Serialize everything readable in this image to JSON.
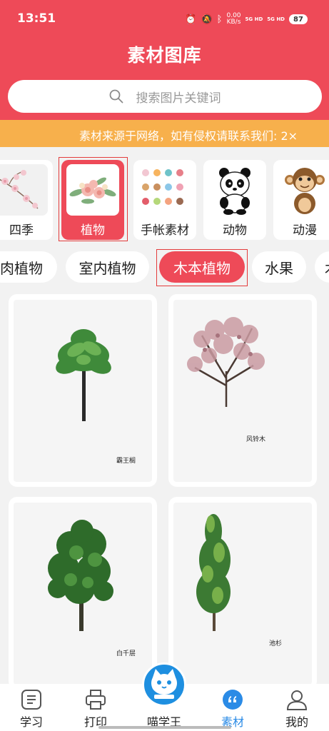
{
  "status_bar": {
    "time": "13:51",
    "net_speed_value": "0.00",
    "net_speed_unit": "KB/s",
    "signal_1": "5G HD",
    "signal_2": "5G HD",
    "battery": "87"
  },
  "header": {
    "title": "素材图库",
    "search_placeholder": "搜索图片关键词"
  },
  "notice": {
    "text": "素材来源于网络，如有侵权请联系我们: 2×"
  },
  "categories": [
    {
      "label": "四季",
      "icon": "blossom-branch"
    },
    {
      "label": "植物",
      "icon": "flower-bouquet",
      "selected": true
    },
    {
      "label": "手帐素材",
      "icon": "sticker-set"
    },
    {
      "label": "动物",
      "icon": "panda"
    },
    {
      "label": "动漫",
      "icon": "monkey"
    }
  ],
  "subcategories": [
    {
      "label": "肉植物"
    },
    {
      "label": "室内植物"
    },
    {
      "label": "木本植物",
      "selected": true
    },
    {
      "label": "水果"
    },
    {
      "label": "木"
    }
  ],
  "items": [
    {
      "caption": "霸王榈",
      "image": "palm-tree"
    },
    {
      "caption": "风铃木",
      "image": "blossom-tree"
    },
    {
      "caption": "白千层",
      "image": "leafy-tree"
    },
    {
      "caption": "池杉",
      "image": "cypress-tree"
    }
  ],
  "bottom_nav": {
    "study": "学习",
    "print": "打印",
    "home": "喵学王",
    "materials": "素材",
    "mine": "我的",
    "active": "materials"
  },
  "colors": {
    "brand_red": "#ee4a58",
    "notice_orange": "#f7b04c",
    "active_blue": "#2b8be6",
    "highlight_box": "#e33c3c"
  }
}
